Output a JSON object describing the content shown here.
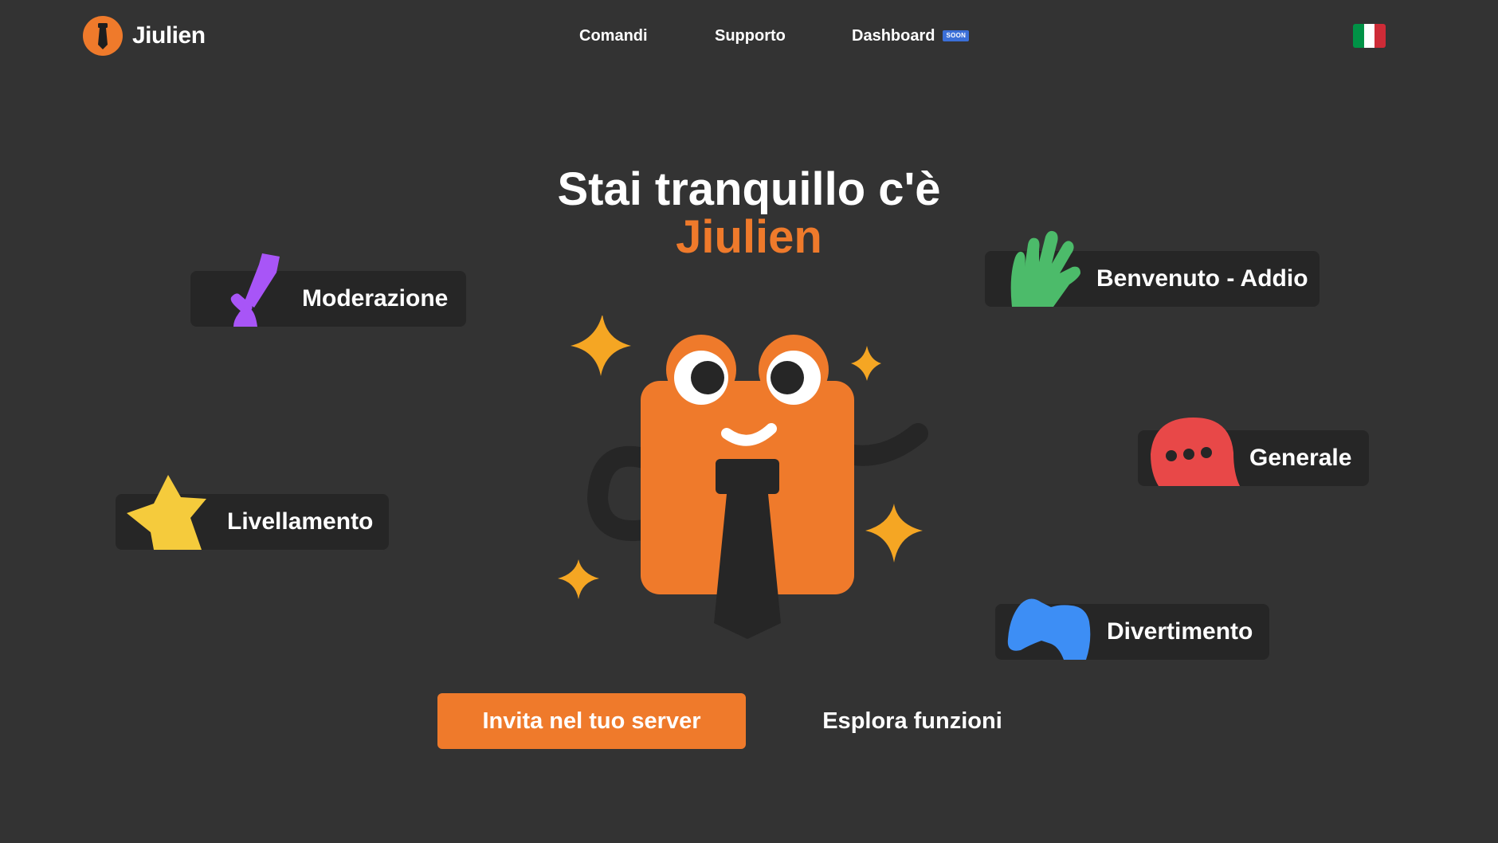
{
  "brand": {
    "name": "Jiulien",
    "accent_color": "#ef7a2b",
    "logo_icon": "tie-logo-icon"
  },
  "nav": {
    "items": [
      {
        "label": "Comandi"
      },
      {
        "label": "Supporto"
      },
      {
        "label": "Dashboard",
        "badge": "SOON"
      }
    ]
  },
  "language": {
    "icon": "italian-flag-icon",
    "colors": [
      "#009246",
      "#ffffff",
      "#ce2b37"
    ]
  },
  "hero": {
    "title_line1": "Stai tranquillo c'è",
    "title_line2": "Jiulien"
  },
  "features": [
    {
      "label": "Moderazione",
      "icon": "sword-icon",
      "color": "#a855f7"
    },
    {
      "label": "Benvenuto - Addio",
      "icon": "waving-hand-icon",
      "color": "#4cbb6a"
    },
    {
      "label": "Generale",
      "icon": "chat-bubble-icon",
      "color": "#e84848"
    },
    {
      "label": "Livellamento",
      "icon": "star-icon",
      "color": "#f5cb3c"
    },
    {
      "label": "Divertimento",
      "icon": "gamepad-icon",
      "color": "#3d8ef5"
    }
  ],
  "mascot": {
    "icon": "jiulien-mascot-icon",
    "body_color": "#ef7a2b",
    "sparkle_color": "#f5a623"
  },
  "cta": {
    "primary_label": "Invita nel tuo server",
    "secondary_label": "Esplora funzioni"
  }
}
